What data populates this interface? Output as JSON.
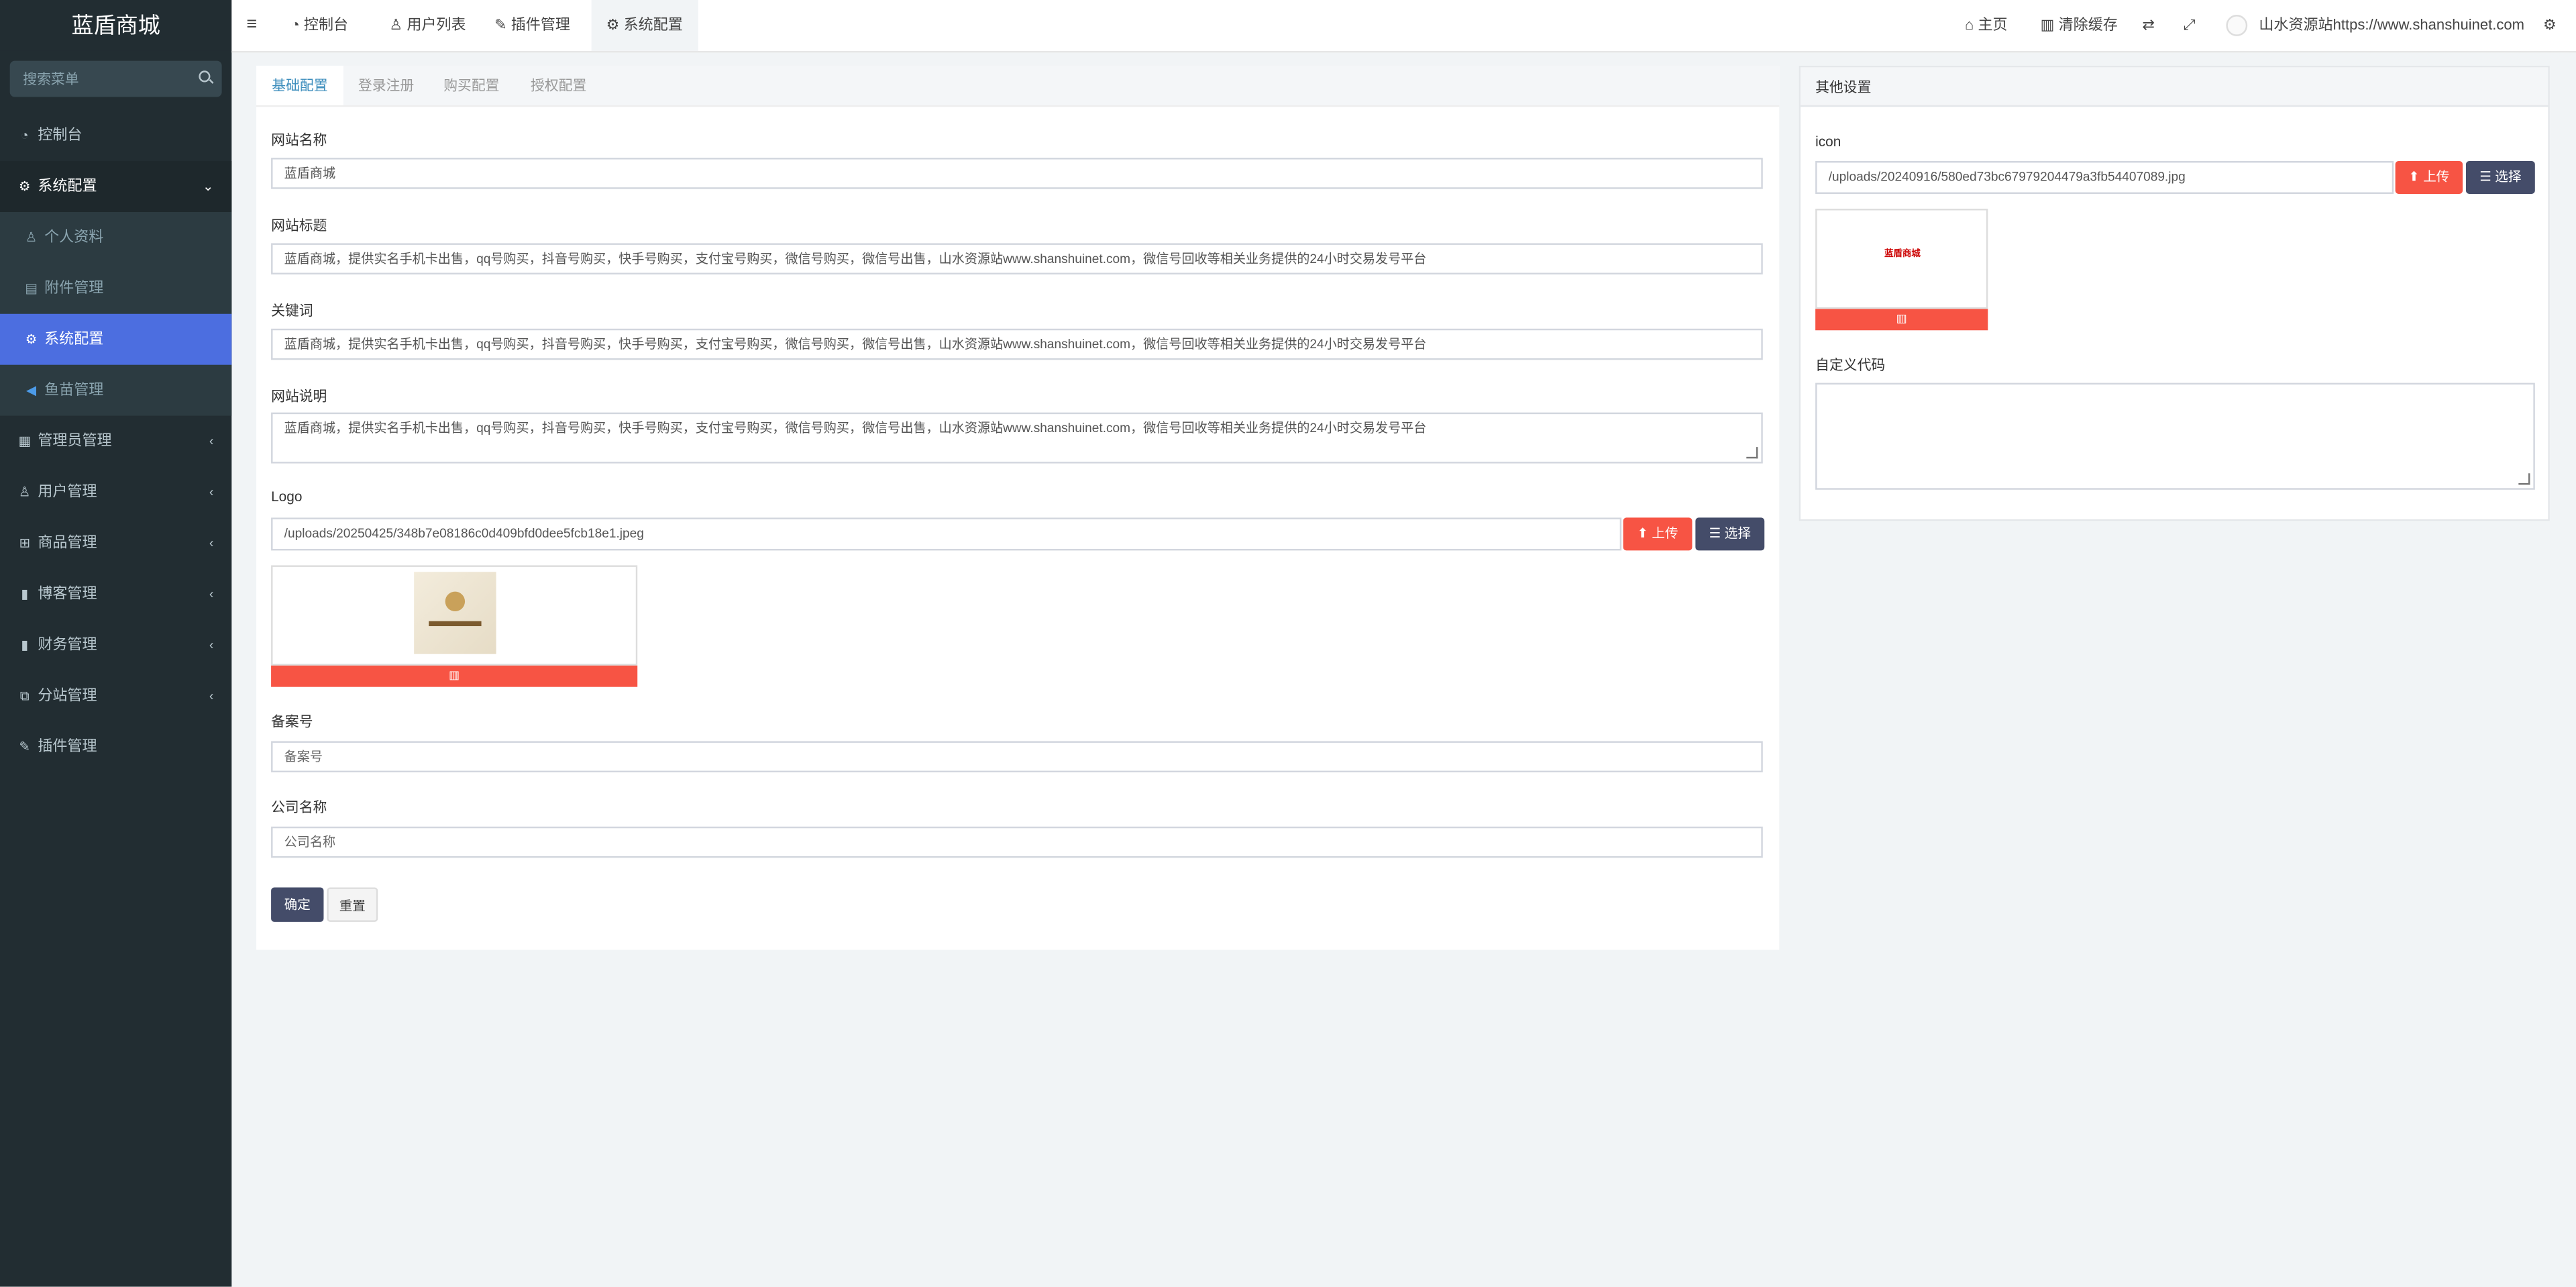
{
  "app": {
    "brand": "蓝盾商城"
  },
  "sidebar": {
    "search_placeholder": "搜索菜单",
    "items": [
      {
        "label": "控制台",
        "icon": "dashboard-icon"
      },
      {
        "label": "系统配置",
        "icon": "cogs-icon",
        "expanded": true
      },
      {
        "label": "个人资料",
        "icon": "user-icon"
      },
      {
        "label": "附件管理",
        "icon": "file-icon"
      },
      {
        "label": "系统配置",
        "icon": "gear-icon",
        "current": true
      },
      {
        "label": "鱼苗管理",
        "icon": "fish-icon"
      },
      {
        "label": "管理员管理",
        "icon": "grid-icon"
      },
      {
        "label": "用户管理",
        "icon": "user-icon"
      },
      {
        "label": "商品管理",
        "icon": "cart-icon"
      },
      {
        "label": "博客管理",
        "icon": "book-icon"
      },
      {
        "label": "财务管理",
        "icon": "bookmark-icon"
      },
      {
        "label": "分站管理",
        "icon": "clone-icon"
      },
      {
        "label": "插件管理",
        "icon": "plug-icon"
      }
    ]
  },
  "topbar": {
    "tabs": [
      "控制台",
      "用户列表",
      "插件管理",
      "系统配置"
    ],
    "home": "主页",
    "clear_cache": "清除缓存",
    "site_name": "山水资源站https://www.shanshuinet.com"
  },
  "form": {
    "tabs": [
      "基础配置",
      "登录注册",
      "购买配置",
      "授权配置"
    ],
    "site_name_label": "网站名称",
    "site_name_value": "蓝盾商城",
    "site_title_label": "网站标题",
    "site_title_value": "蓝盾商城，提供实名手机卡出售，qq号购买，抖音号购买，快手号购买，支付宝号购买，微信号购买，微信号出售，山水资源站www.shanshuinet.com，微信号回收等相关业务提供的24小时交易发号平台",
    "keywords_label": "关键词",
    "keywords_value": "蓝盾商城，提供实名手机卡出售，qq号购买，抖音号购买，快手号购买，支付宝号购买，微信号购买，微信号出售，山水资源站www.shanshuinet.com，微信号回收等相关业务提供的24小时交易发号平台",
    "description_label": "网站说明",
    "description_value": "蓝盾商城，提供实名手机卡出售，qq号购买，抖音号购买，快手号购买，支付宝号购买，微信号购买，微信号出售，山水资源站www.shanshuinet.com，微信号回收等相关业务提供的24小时交易发号平台",
    "logo_label": "Logo",
    "logo_value": "/uploads/20250425/348b7e08186c0d409bfd0dee5fcb18e1.jpeg",
    "upload_label": "上传",
    "choose_label": "选择",
    "beian_label": "备案号",
    "beian_placeholder": "备案号",
    "company_label": "公司名称",
    "company_placeholder": "公司名称",
    "confirm_label": "确定",
    "reset_label": "重置"
  },
  "other": {
    "title": "其他设置",
    "icon_label": "icon",
    "icon_value": "/uploads/20240916/580ed73bc67979204479a3fb54407089.jpg",
    "icon_preview_text": "蓝盾商城",
    "custom_code_label": "自定义代码",
    "upload_label": "上传",
    "choose_label": "选择"
  },
  "colors": {
    "sidebar_bg": "#222d32",
    "active_item": "#4c6ee0",
    "danger": "#f75444",
    "primary_dark": "#444c69",
    "tab_active": "#3c8dbc"
  }
}
